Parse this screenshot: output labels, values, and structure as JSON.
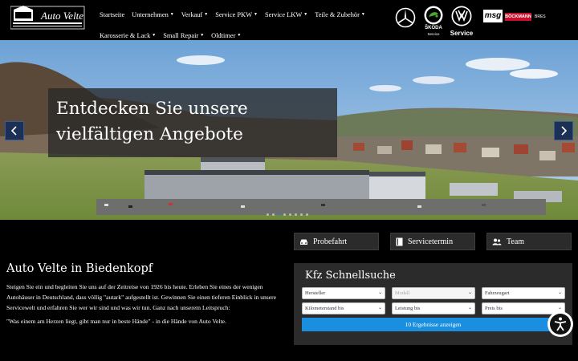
{
  "header": {
    "logo_text": "Auto Velte",
    "nav_row1": [
      {
        "label": "Startseite",
        "caret": false
      },
      {
        "label": "Unternehmen",
        "caret": true
      },
      {
        "label": "Verkauf",
        "caret": true
      },
      {
        "label": "Service PKW",
        "caret": true
      },
      {
        "label": "Service LKW",
        "caret": true
      },
      {
        "label": "Teile & Zubehör",
        "caret": true
      }
    ],
    "nav_row2": [
      {
        "label": "Karosserie & Lack",
        "caret": true
      },
      {
        "label": "Small Repair",
        "caret": true
      },
      {
        "label": "Oldtimer",
        "caret": true
      }
    ],
    "brands": {
      "skoda_name": "ŠKODA",
      "skoda_sub": "Service",
      "vw_sub": "Service",
      "msg": "msg",
      "bockmann": "BÖCKMANN",
      "brendes": "BRES"
    }
  },
  "hero": {
    "headline": "Entdecken Sie unsere vielfältigen Angebote",
    "slide_count": 8,
    "active_slide": 2
  },
  "quick_buttons": [
    {
      "label": "Probefahrt",
      "icon": "car-icon"
    },
    {
      "label": "Servicetermin",
      "icon": "book-icon"
    },
    {
      "label": "Team",
      "icon": "users-icon"
    }
  ],
  "about": {
    "title": "Auto Velte in Biedenkopf",
    "text": "Steigen Sie ein und begleiten Sie uns auf der Zeitreise von 1926 bis heute. Erleben Sie eines der wenigen Autohäuser in Deutschland, dass völlig \"autark\" aufgestellt ist. Gewinnen Sie einen tieferen Einblick in unsere Servicewelt und erfahren Sie wer wir sind und was wir tun. Ganz nach unserem Leitspruch:",
    "quote": "\"Was einem am Herzen liegt, gibt man nur in beste Hände\" - in die Hände von Auto Velte."
  },
  "search": {
    "title": "Kfz Schnellsuche",
    "fields_row1": [
      "Hersteller",
      "Modell",
      "Fahrzeugart"
    ],
    "fields_row2": [
      "Kilometerstand bis",
      "Leistung bis",
      "Preis bis"
    ],
    "submit": "10 Ergebnisse anzeigen"
  },
  "colors": {
    "accent": "#1a8fe0",
    "arrow_bg": "#1c2f55",
    "panel": "#2b2b2b"
  }
}
